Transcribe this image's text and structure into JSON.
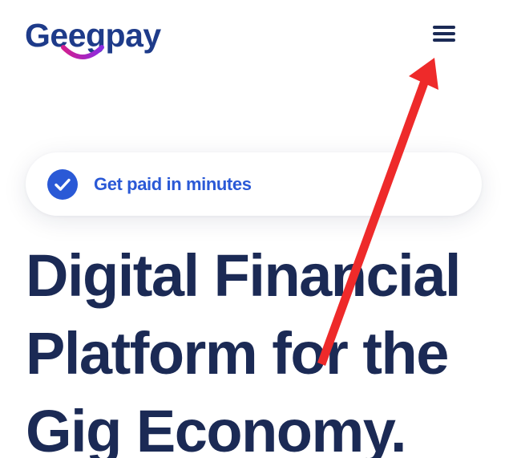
{
  "header": {
    "logo_text": "Geegpay",
    "menu_icon": "hamburger-menu-icon"
  },
  "badge": {
    "icon": "check-circle-icon",
    "text": "Get paid in minutes"
  },
  "hero": {
    "title_lines": [
      "Digital Financial",
      "Platform for the",
      "Gig Economy."
    ]
  },
  "annotation": {
    "icon": "red-arrow-icon",
    "color": "#ee2a2a"
  },
  "colors": {
    "brand_blue": "#1e3b8a",
    "accent_blue": "#2a59d6",
    "heading_navy": "#1b2a55",
    "smile_purple": "#b12ad1",
    "arrow_red": "#ee2a2a"
  }
}
